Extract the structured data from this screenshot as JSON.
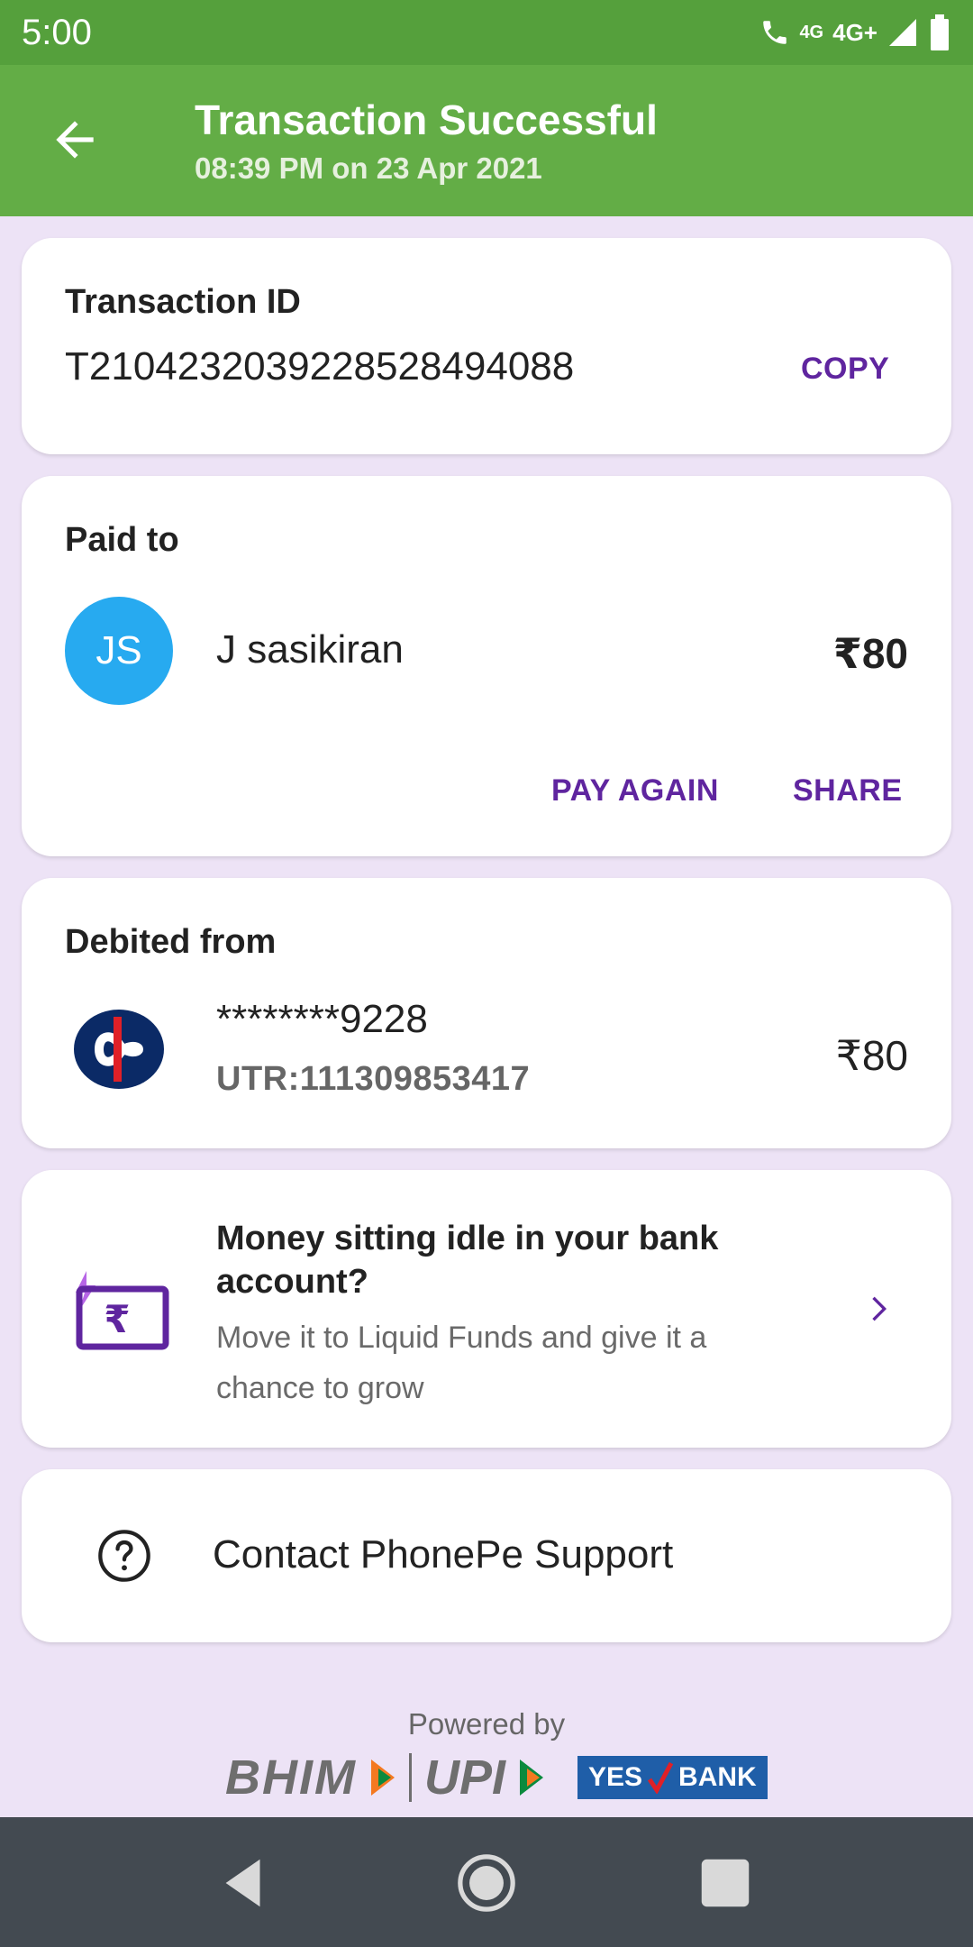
{
  "status_bar": {
    "time": "5:00",
    "network_small": "4G",
    "network": "4G+"
  },
  "header": {
    "title": "Transaction Successful",
    "subtitle": "08:39 PM on 23 Apr 2021",
    "back_icon": "arrow-left-icon"
  },
  "transaction": {
    "label": "Transaction ID",
    "id": "T2104232039228528494088",
    "copy_label": "COPY"
  },
  "paid_to": {
    "label": "Paid to",
    "avatar_initials": "JS",
    "avatar_color": "#27aaf0",
    "name": "J sasikiran",
    "amount": "₹80",
    "pay_again_label": "PAY AGAIN",
    "share_label": "SHARE"
  },
  "debited_from": {
    "label": "Debited from",
    "account": "********9228",
    "utr": "UTR:111309853417",
    "amount": "₹80",
    "bank_icon": "kotak-bank-logo"
  },
  "promo": {
    "title": "Money sitting idle in your bank account?",
    "subtitle": "Move it to Liquid Funds and give it a chance to grow",
    "icon": "rupee-wallet-icon"
  },
  "support": {
    "label": "Contact PhonePe Support",
    "icon": "help-circle-icon"
  },
  "footer": {
    "powered_by": "Powered by",
    "bhim": "BHIM",
    "upi": "UPI",
    "yes": "YES",
    "bank": "BANK"
  },
  "colors": {
    "accent": "#5f259f",
    "header": "#63ad46",
    "status_bar": "#55a03c",
    "background": "#ede3f6"
  }
}
